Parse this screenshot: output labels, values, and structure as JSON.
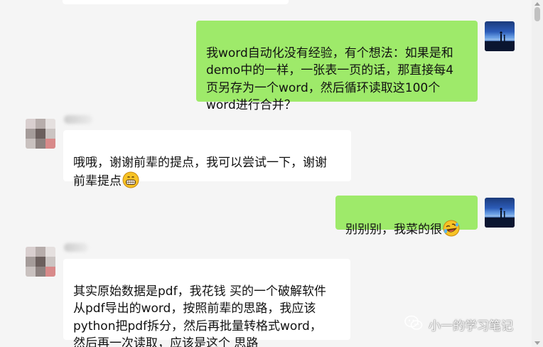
{
  "messages": [
    {
      "sender": "me",
      "text": "我word自动化没有经验，有个想法：如果是和\ndemo中的一样，一张表一页的话，那直接每4\n页另存为一个word，然后循环读取这100个\nword进行合并？"
    },
    {
      "sender": "other",
      "text": "哦哦，谢谢前辈的提点，我可以尝试一下，谢谢\n前辈提点",
      "emoji": "grinning-face-emoji"
    },
    {
      "sender": "me",
      "text": "别别别，我菜的很",
      "emoji": "rolling-laughing-emoji"
    },
    {
      "sender": "other",
      "text": "其实原始数据是pdf，我花钱 买的一个破解软件\n从pdf导出的word，按照前辈的思路，我应该\npython把pdf拆分，然后再批量转格式word，\n然后再一次读取，应该是这个 思路"
    }
  ],
  "watermark": {
    "text": "小一的学习笔记",
    "icon": "wechat-icon"
  },
  "colors": {
    "background": "#f5f5f5",
    "my_bubble": "#9eea6a",
    "other_bubble": "#ffffff"
  }
}
